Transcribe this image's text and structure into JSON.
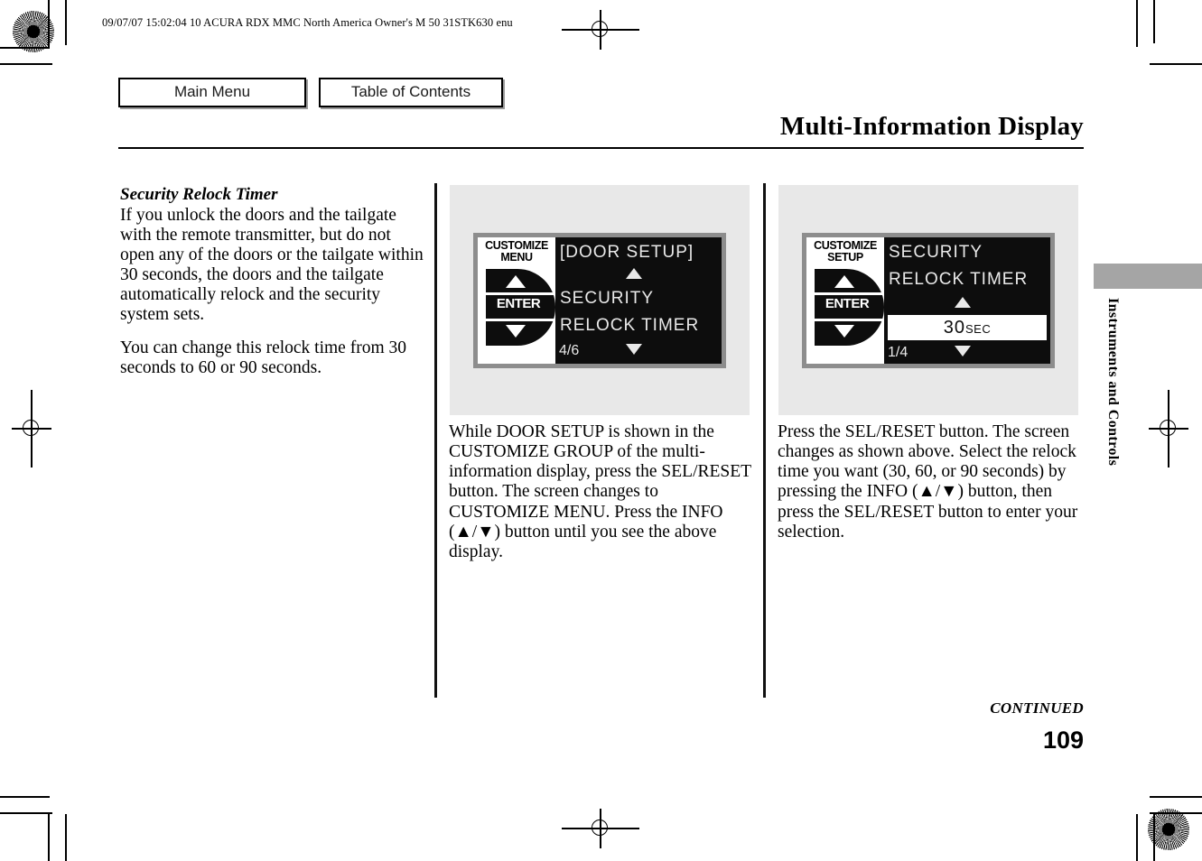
{
  "header": {
    "slug": "09/07/07 15:02:04    10 ACURA RDX MMC North America Owner's M 50 31STK630 enu"
  },
  "nav": {
    "main_menu_label": "Main Menu",
    "table_of_contents_label": "Table of Contents"
  },
  "title": "Multi-Information Display",
  "left_column": {
    "heading": "Security Relock Timer",
    "paragraph_1": "If you unlock the doors and the tailgate with the remote transmitter, but do not open any of the doors or the tailgate within 30 seconds, the doors and the tailgate automatically relock and the security system sets.",
    "paragraph_2": "You can change this relock time from 30 seconds to 60 or 90 seconds."
  },
  "figure_1": {
    "panel_label_line_1": "CUSTOMIZE",
    "panel_label_line_2": "MENU",
    "enter_label": "ENTER",
    "screen_line_1": "[DOOR SETUP]",
    "screen_line_2": "SECURITY",
    "screen_line_3": "RELOCK TIMER",
    "page_indicator": "4/6",
    "up_arrow": "▲",
    "down_arrow": "▼"
  },
  "figure_2": {
    "panel_label_line_1": "CUSTOMIZE",
    "panel_label_line_2": "SETUP",
    "enter_label": "ENTER",
    "screen_line_1": "SECURITY",
    "screen_line_2": "RELOCK TIMER",
    "highlight_value": "30",
    "highlight_unit": "SEC",
    "page_indicator": "1/4",
    "up_arrow": "▲",
    "down_arrow": "▼"
  },
  "caption_1": "While DOOR SETUP is shown in the CUSTOMIZE GROUP of the multi-information display, press the SEL/RESET button. The screen changes to CUSTOMIZE MENU. Press the INFO (▲/▼) button until you see the above display.",
  "caption_2": "Press the SEL/RESET button. The screen changes as shown above. Select the relock time you want (30, 60, or 90 seconds) by pressing the INFO (▲/▼) button, then press the SEL/RESET button to enter your selection.",
  "side_tab": {
    "label": "Instruments and Controls"
  },
  "footer": {
    "continued": "CONTINUED",
    "page_number": "109"
  },
  "colors": {
    "panel_gray": "#e8e8e8",
    "lcd_bezel": "#8d8d8d",
    "lcd_screen": "#0d0d0d",
    "side_tab_gray": "#a5a5a5",
    "button_shadow": "#9a9a9a"
  }
}
